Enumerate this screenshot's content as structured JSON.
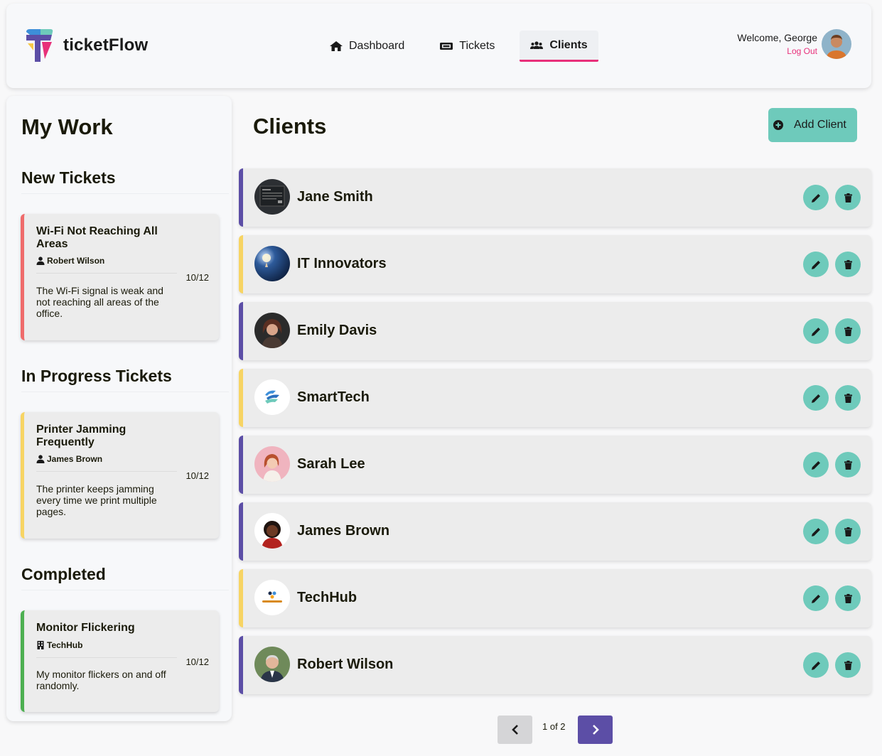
{
  "app": {
    "name": "ticketFlow"
  },
  "nav": [
    {
      "label": "Dashboard",
      "icon": "home-icon"
    },
    {
      "label": "Tickets",
      "icon": "ticket-icon"
    },
    {
      "label": "Clients",
      "icon": "users-icon",
      "active": true
    }
  ],
  "user": {
    "welcome": "Welcome, George",
    "logout": "Log Out"
  },
  "sidebar": {
    "title": "My Work",
    "sections": [
      {
        "title": "New Tickets",
        "ticket": {
          "title": "Wi-Fi Not Reaching All Areas",
          "who": "Robert Wilson",
          "who_icon": "user-icon",
          "date": "10/12",
          "description": "The Wi-Fi signal is weak and not reaching all areas of the office.",
          "accent": "#ef6b6b"
        }
      },
      {
        "title": "In Progress Tickets",
        "ticket": {
          "title": "Printer Jamming Frequently",
          "who": "James Brown",
          "who_icon": "user-icon",
          "date": "10/12",
          "description": "The printer keeps jamming every time we print multiple pages.",
          "accent": "#f7d463"
        }
      },
      {
        "title": "Completed",
        "ticket": {
          "title": "Monitor Flickering",
          "who": "TechHub",
          "who_icon": "building-icon",
          "date": "10/12",
          "description": "My monitor flickers on and off randomly.",
          "accent": "#4caf50"
        }
      }
    ]
  },
  "main": {
    "title": "Clients",
    "add_button": "Add Client",
    "clients": [
      {
        "name": "Jane Smith",
        "type": "person",
        "accent": "#5c4ea6"
      },
      {
        "name": "IT Innovators",
        "type": "company",
        "accent": "#f7d463"
      },
      {
        "name": "Emily Davis",
        "type": "person",
        "accent": "#5c4ea6"
      },
      {
        "name": "SmartTech",
        "type": "company",
        "accent": "#f7d463"
      },
      {
        "name": "Sarah Lee",
        "type": "person",
        "accent": "#5c4ea6"
      },
      {
        "name": "James Brown",
        "type": "person",
        "accent": "#5c4ea6"
      },
      {
        "name": "TechHub",
        "type": "company",
        "accent": "#f7d463"
      },
      {
        "name": "Robert Wilson",
        "type": "person",
        "accent": "#5c4ea6"
      }
    ]
  },
  "pagination": {
    "label": "1 of 2"
  },
  "colors": {
    "brand_purple": "#5c4ea6",
    "teal": "#6ecabb",
    "pink": "#e8307a"
  }
}
